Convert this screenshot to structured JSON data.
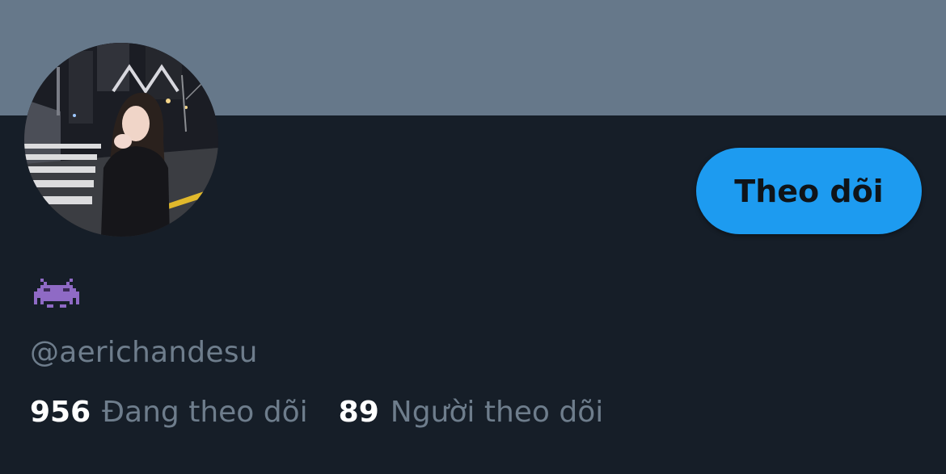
{
  "profile": {
    "display_name_icon": "alien-monster-icon",
    "handle": "@aerichandesu",
    "follow_button_label": "Theo dõi",
    "stats": {
      "following_count": "956",
      "following_label": "Đang theo dõi",
      "followers_count": "89",
      "followers_label": "Người theo dõi"
    }
  },
  "colors": {
    "background": "#161e28",
    "banner": "#66788a",
    "accent": "#1d9bf0",
    "secondary_text": "#6e7d8c",
    "primary_text": "#ffffff",
    "emoji_purple": "#8f6ac5"
  }
}
